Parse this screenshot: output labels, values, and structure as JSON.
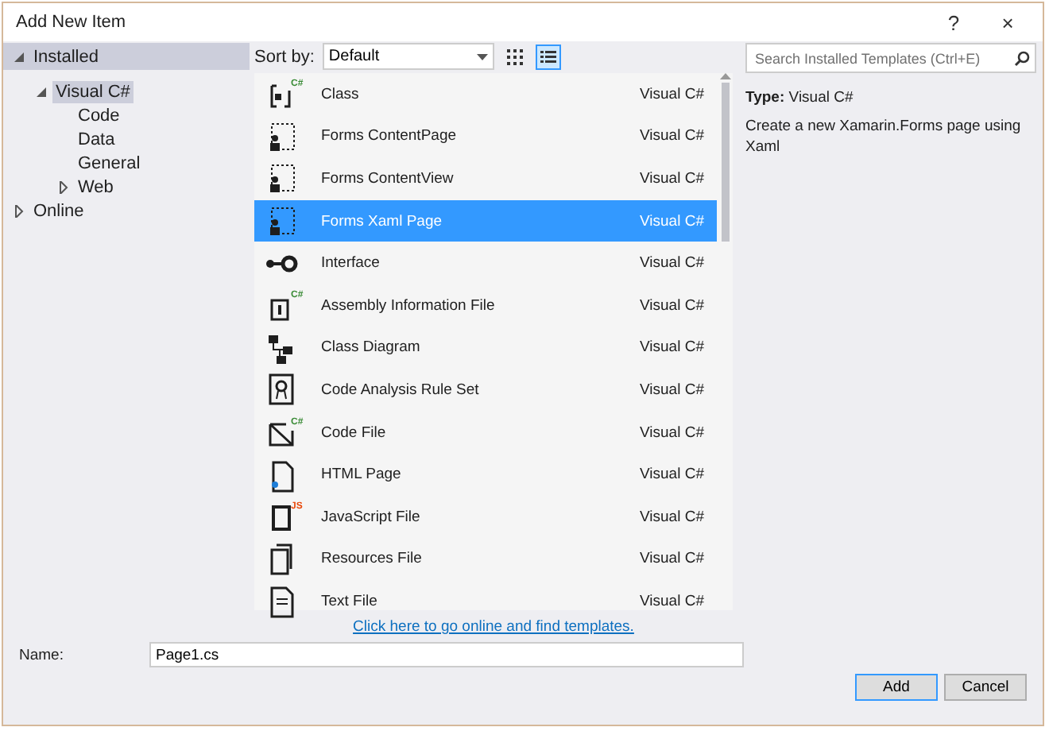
{
  "window": {
    "title": "Add New Item",
    "help": "?",
    "close": "×"
  },
  "tree": [
    {
      "label": "Installed",
      "expanded": true,
      "selected": true,
      "children": [
        {
          "label": "Visual C#",
          "expanded": true,
          "selected": true,
          "children": [
            {
              "label": "Code",
              "selected": false
            },
            {
              "label": "Data",
              "selected": false
            },
            {
              "label": "General",
              "selected": false
            },
            {
              "label": "Web",
              "expanded": false,
              "selected": false
            }
          ]
        }
      ]
    },
    {
      "label": "Online",
      "expanded": false,
      "selected": false
    }
  ],
  "toolbar": {
    "sort_label": "Sort by:",
    "sort_value": "Default",
    "views": [
      {
        "kind": "grid",
        "selected": false
      },
      {
        "kind": "list",
        "selected": true
      }
    ]
  },
  "search": {
    "placeholder": "Search Installed Templates (Ctrl+E)"
  },
  "templates": [
    {
      "name": "Class",
      "language": "Visual C#",
      "kind": "class",
      "badge": "C#",
      "selected": false
    },
    {
      "name": "Forms ContentPage",
      "language": "Visual C#",
      "kind": "form",
      "selected": false
    },
    {
      "name": "Forms ContentView",
      "language": "Visual C#",
      "kind": "form",
      "selected": false
    },
    {
      "name": "Forms Xaml Page",
      "language": "Visual C#",
      "kind": "form",
      "selected": true
    },
    {
      "name": "Interface",
      "language": "Visual C#",
      "kind": "interface",
      "selected": false
    },
    {
      "name": "Assembly Information File",
      "language": "Visual C#",
      "kind": "info",
      "badge": "C#",
      "selected": false
    },
    {
      "name": "Class Diagram",
      "language": "Visual C#",
      "kind": "diagram",
      "selected": false
    },
    {
      "name": "Code Analysis Rule Set",
      "language": "Visual C#",
      "kind": "ruleset",
      "selected": false
    },
    {
      "name": "Code File",
      "language": "Visual C#",
      "kind": "code",
      "badge": "C#",
      "selected": false
    },
    {
      "name": "HTML Page",
      "language": "Visual C#",
      "kind": "html",
      "selected": false
    },
    {
      "name": "JavaScript File",
      "language": "Visual C#",
      "kind": "js",
      "badge": "JS",
      "selected": false
    },
    {
      "name": "Resources File",
      "language": "Visual C#",
      "kind": "resources",
      "selected": false
    },
    {
      "name": "Text File",
      "language": "Visual C#",
      "kind": "text",
      "selected": false
    }
  ],
  "details": {
    "type_label": "Type:",
    "type_value": "Visual C#",
    "description": "Create a new Xamarin.Forms page using Xaml"
  },
  "online_link": "Click here to go online and find templates.",
  "name_field": {
    "label": "Name:",
    "value": "Page1.cs"
  },
  "buttons": [
    {
      "label": "Add",
      "default": true
    },
    {
      "label": "Cancel",
      "default": false
    }
  ]
}
